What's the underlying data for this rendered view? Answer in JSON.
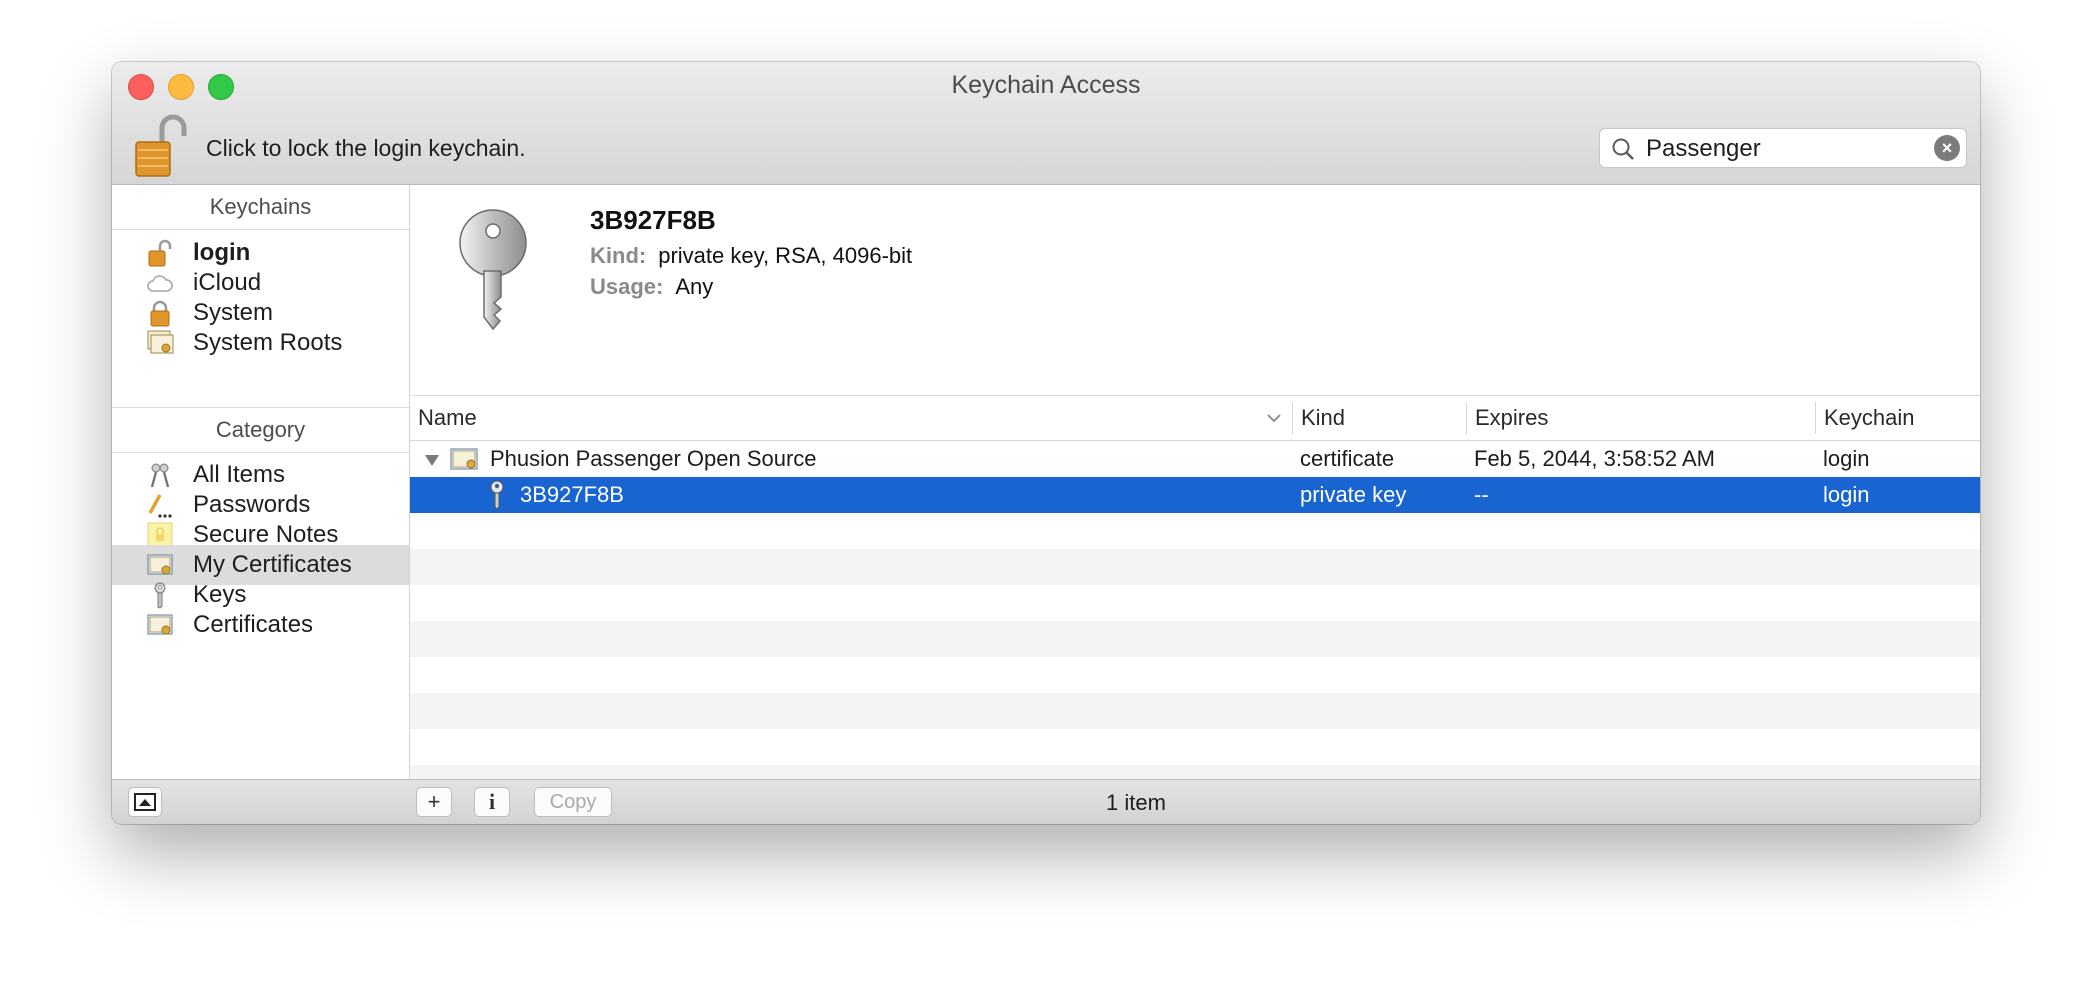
{
  "window": {
    "title": "Keychain Access"
  },
  "toolbar": {
    "lock_label": "Click to lock the login keychain.",
    "search": {
      "value": "Passenger",
      "placeholder": "Search"
    }
  },
  "sidebar": {
    "keychains_header": "Keychains",
    "keychains": [
      {
        "label": "login",
        "icon": "lock-open-icon",
        "bold": true
      },
      {
        "label": "iCloud",
        "icon": "cloud-icon"
      },
      {
        "label": "System",
        "icon": "lock-icon"
      },
      {
        "label": "System Roots",
        "icon": "certificate-stack-icon"
      }
    ],
    "category_header": "Category",
    "categories": [
      {
        "label": "All Items",
        "icon": "keys-icon"
      },
      {
        "label": "Passwords",
        "icon": "pencil-dots-icon"
      },
      {
        "label": "Secure Notes",
        "icon": "note-icon"
      },
      {
        "label": "My Certificates",
        "icon": "certificate-icon",
        "selected": true
      },
      {
        "label": "Keys",
        "icon": "key-icon"
      },
      {
        "label": "Certificates",
        "icon": "certificate-icon"
      }
    ]
  },
  "detail": {
    "name": "3B927F8B",
    "kind_label": "Kind:",
    "kind_value": "private key, RSA, 4096-bit",
    "usage_label": "Usage:",
    "usage_value": "Any"
  },
  "table": {
    "columns": [
      "Name",
      "Kind",
      "Expires",
      "Keychain"
    ],
    "rows": [
      {
        "name": "Phusion Passenger Open Source",
        "kind": "certificate",
        "expires": "Feb 5, 2044, 3:58:52 AM",
        "keychain": "login",
        "expanded": true
      },
      {
        "name": "3B927F8B",
        "kind": "private key",
        "expires": "--",
        "keychain": "login",
        "selected": true
      }
    ]
  },
  "footer": {
    "add_label": "+",
    "info_label": "i",
    "copy_label": "Copy",
    "status": "1 item"
  },
  "colors": {
    "selection": "#1865d2",
    "accent_lock": "#e0952c"
  }
}
